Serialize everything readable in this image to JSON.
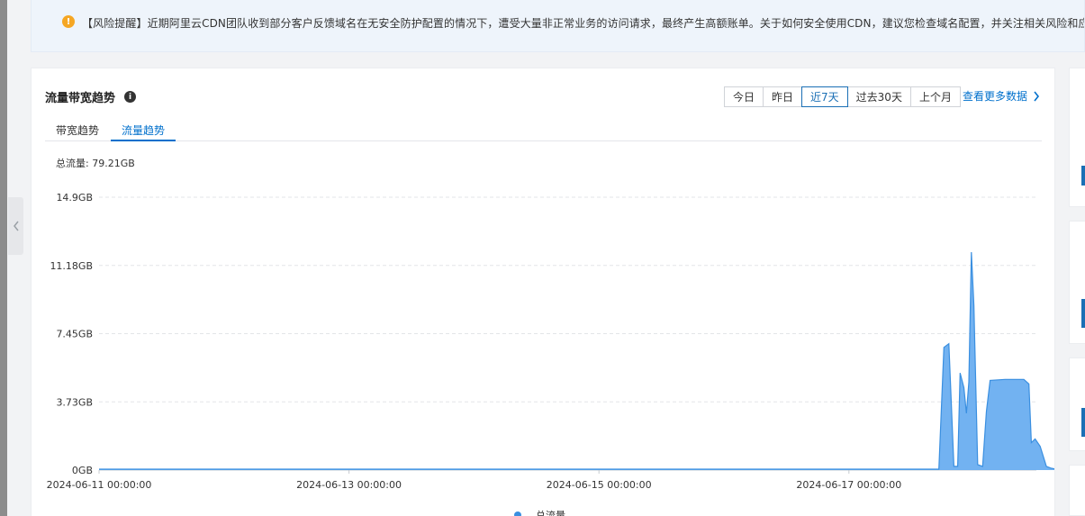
{
  "notice": {
    "text": "【风险提醒】近期阿里云CDN团队收到部分客户反馈域名在无安全防护配置的情况下，遭受大量非正常业务的访问请求，最终产生高额账单。关于如何安全使用CDN，建议您检查域名配置，并关注相关风险和应对"
  },
  "panel": {
    "title": "流量带宽趋势",
    "ranges": [
      "今日",
      "昨日",
      "近7天",
      "过去30天",
      "上个月"
    ],
    "active_range": "近7天",
    "more_link": "查看更多数据",
    "tabs": [
      "带宽趋势",
      "流量趋势"
    ],
    "active_tab": "流量趋势",
    "total_label": "总流量: 79.21GB",
    "legend_label": "总流量"
  },
  "colors": {
    "accent": "#0070cc",
    "area_fill": "#6aaef0",
    "area_stroke": "#3a8fe0",
    "warning": "#f5a623"
  },
  "chart_data": {
    "type": "area",
    "y_ticks": [
      "0GB",
      "3.73GB",
      "7.45GB",
      "11.18GB",
      "14.9GB"
    ],
    "ylim": [
      0,
      14.9
    ],
    "x_ticks": [
      "2024-06-11 00:00:00",
      "2024-06-13 00:00:00",
      "2024-06-15 00:00:00",
      "2024-06-17 00:00:00"
    ],
    "xlim_days": [
      0,
      7.5
    ],
    "series": [
      {
        "name": "总流量",
        "points": [
          [
            0,
            0.05
          ],
          [
            6.65,
            0.05
          ],
          [
            6.72,
            0.05
          ],
          [
            6.76,
            6.7
          ],
          [
            6.8,
            6.9
          ],
          [
            6.84,
            0.2
          ],
          [
            6.87,
            0.2
          ],
          [
            6.89,
            5.3
          ],
          [
            6.92,
            4.5
          ],
          [
            6.94,
            3.1
          ],
          [
            6.96,
            4.8
          ],
          [
            6.98,
            11.9
          ],
          [
            7.0,
            9.0
          ],
          [
            7.03,
            0.3
          ],
          [
            7.07,
            0.2
          ],
          [
            7.1,
            3.2
          ],
          [
            7.13,
            4.9
          ],
          [
            7.25,
            4.95
          ],
          [
            7.4,
            4.95
          ],
          [
            7.44,
            4.7
          ],
          [
            7.46,
            1.5
          ],
          [
            7.49,
            1.7
          ],
          [
            7.53,
            1.3
          ],
          [
            7.58,
            0.2
          ],
          [
            7.62,
            0.1
          ],
          [
            7.66,
            0.05
          ],
          [
            7.7,
            0.05
          ]
        ]
      }
    ]
  }
}
